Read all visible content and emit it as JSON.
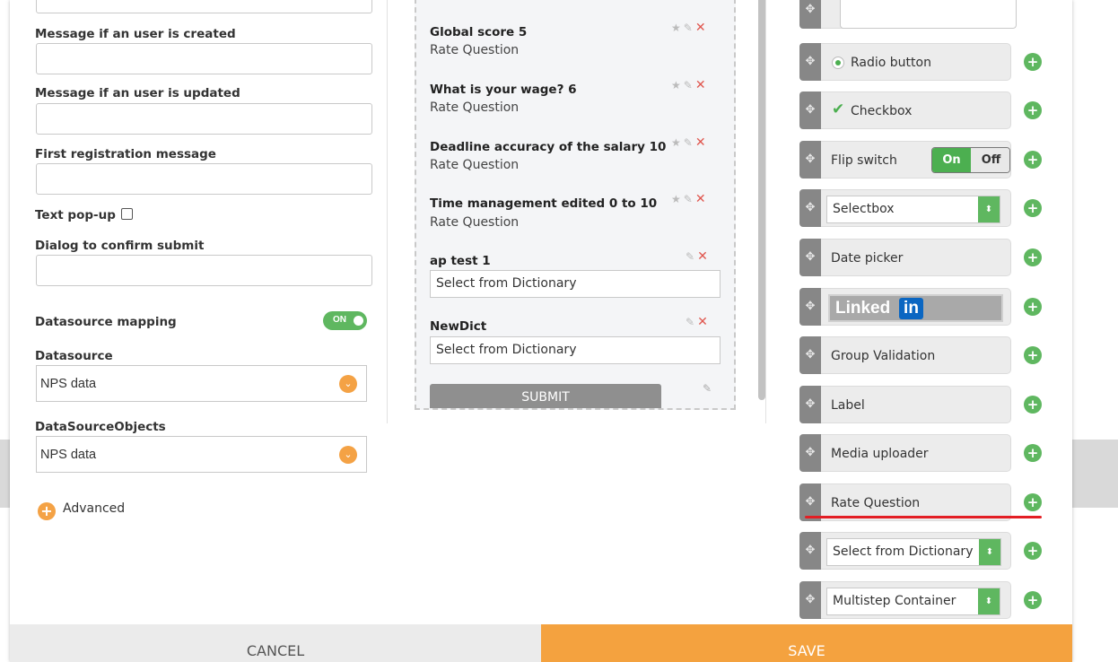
{
  "settings": {
    "msg_created_label": "Message if an user is created",
    "msg_updated_label": "Message if an user is updated",
    "first_reg_label": "First registration message",
    "text_popup_label": "Text pop-up",
    "dialog_confirm_label": "Dialog to confirm submit",
    "ds_mapping_label": "Datasource mapping",
    "ds_mapping_toggle": "ON",
    "datasource_label": "Datasource",
    "datasource_value": "NPS data",
    "ds_objects_label": "DataSourceObjects",
    "ds_objects_value": "NPS data",
    "advanced_label": "Advanced"
  },
  "preview": {
    "questions": [
      {
        "title": "Global score 5",
        "subtitle": "Rate Question"
      },
      {
        "title": "What is your wage? 6",
        "subtitle": "Rate Question"
      },
      {
        "title": "Deadline accuracy of the salary 10",
        "subtitle": "Rate Question"
      },
      {
        "title": "Time management edited 0 to 10",
        "subtitle": "Rate Question"
      },
      {
        "title": "ap test 1",
        "select_value": "Select from Dictionary"
      },
      {
        "title": "NewDict",
        "select_value": "Select from Dictionary"
      }
    ],
    "submit_label": "SUBMIT"
  },
  "palette": {
    "radio": "Radio button",
    "checkbox": "Checkbox",
    "flip_switch": "Flip switch",
    "flip_on": "On",
    "flip_off": "Off",
    "selectbox": "Selectbox",
    "date_picker": "Date picker",
    "linkedin_text": "Linked",
    "linkedin_in": "in",
    "group_validation": "Group Validation",
    "label": "Label",
    "media_uploader": "Media uploader",
    "rate_question": "Rate Question",
    "select_dictionary": "Select from Dictionary",
    "multistep": "Multistep Container"
  },
  "footer": {
    "cancel": "CANCEL",
    "save": "SAVE"
  },
  "colors": {
    "accent_orange": "#f4a23f",
    "accent_green": "#5fb760",
    "delete_red": "#e0574f",
    "highlight_red": "#e31e24"
  }
}
